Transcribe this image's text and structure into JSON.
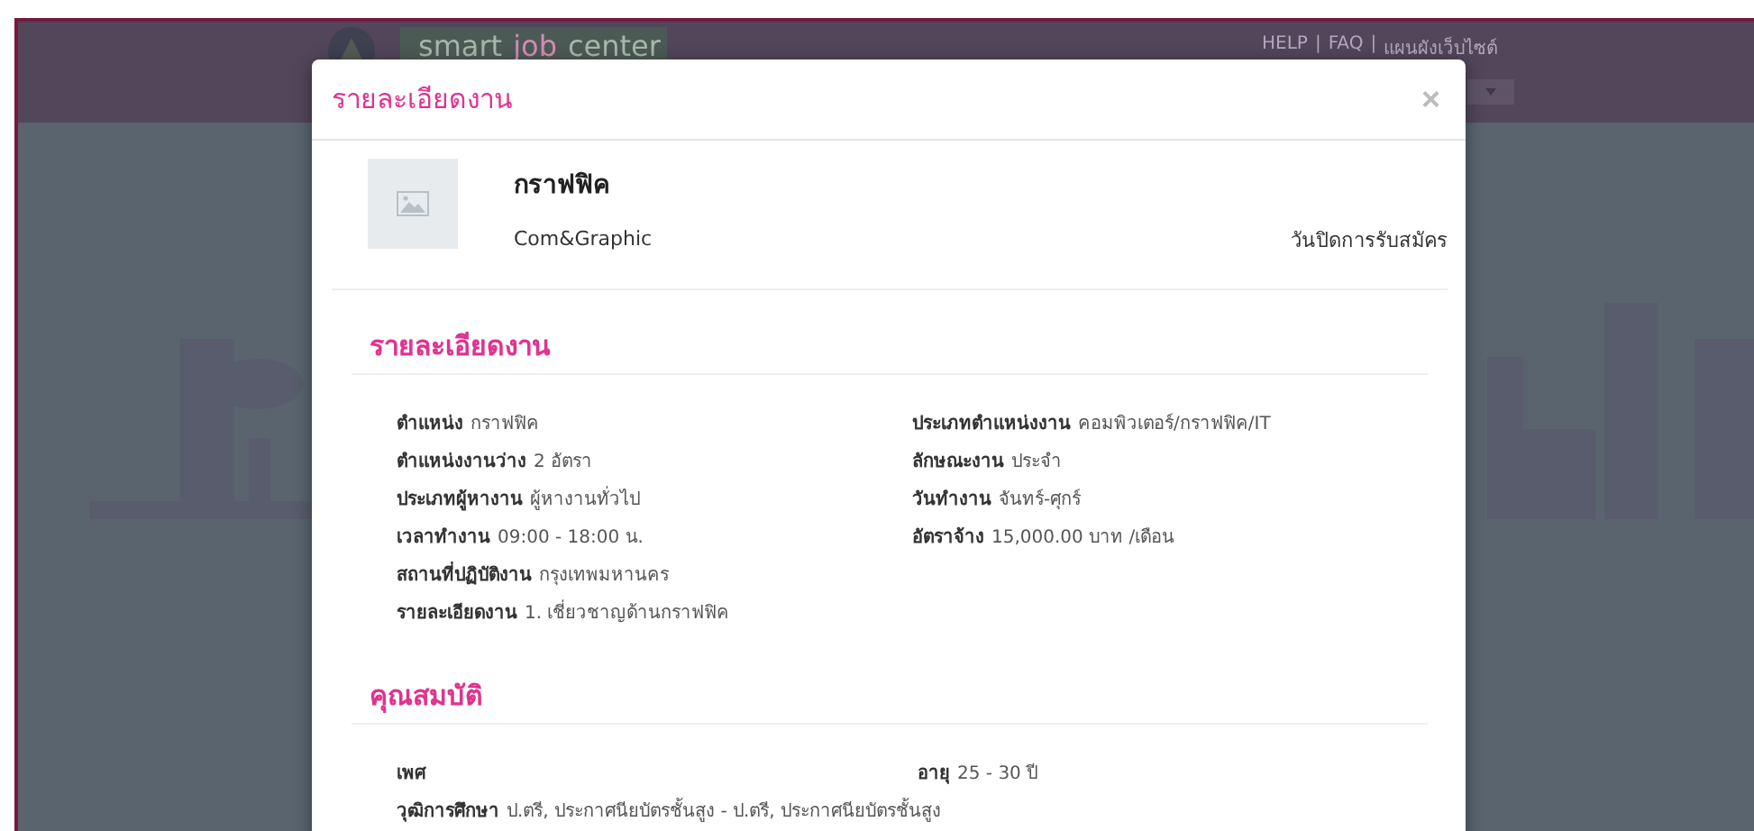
{
  "header": {
    "logo_words": [
      "smart",
      "job",
      "center"
    ],
    "links": [
      "HELP",
      "FAQ",
      "แผนผังเว็บไซต์"
    ],
    "link_separator": "|"
  },
  "modal": {
    "title": "รายละเอียดงาน",
    "close": "×",
    "job": {
      "title": "กราฟฟิค",
      "company": "Com&Graphic",
      "closing_label": "วันปิดการรับสมัคร"
    },
    "sections": [
      {
        "title": "รายละเอียดงาน",
        "left": [
          {
            "label": "ตำแหน่ง",
            "value": "กราฟฟิค"
          },
          {
            "label": "ตำแหน่งงานว่าง",
            "value": "2 อัตรา"
          },
          {
            "label": "ประเภทผู้หางาน",
            "value": "ผู้หางานทั่วไป"
          },
          {
            "label": "เวลาทำงาน",
            "value": "09:00 - 18:00 น."
          },
          {
            "label": "สถานที่ปฏิบัติงาน",
            "value": "กรุงเทพมหานคร"
          },
          {
            "label": "รายละเอียดงาน",
            "value": "1. เชี่ยวชาญด้านกราฟฟิค"
          }
        ],
        "right": [
          {
            "label": "ประเภทตำแหน่งงาน",
            "value": "คอมพิวเตอร์/กราฟฟิค/IT"
          },
          {
            "label": "ลักษณะงาน",
            "value": "ประจำ"
          },
          {
            "label": "วันทำงาน",
            "value": "จันทร์-ศุกร์"
          },
          {
            "label": "อัตราจ้าง",
            "value": "15,000.00 บาท /เดือน"
          }
        ]
      },
      {
        "title": "คุณสมบัติ",
        "left": [
          {
            "label": "เพศ"
          },
          {
            "label": "วุฒิการศึกษา",
            "value": "ป.ตรี, ประกาศนียบัตรชั้นสูง - ป.ตรี, ประกาศนียบัตรชั้นสูง"
          }
        ],
        "right": [
          {
            "label": "อายุ",
            "value": "25 - 30 ปี"
          }
        ]
      }
    ]
  }
}
